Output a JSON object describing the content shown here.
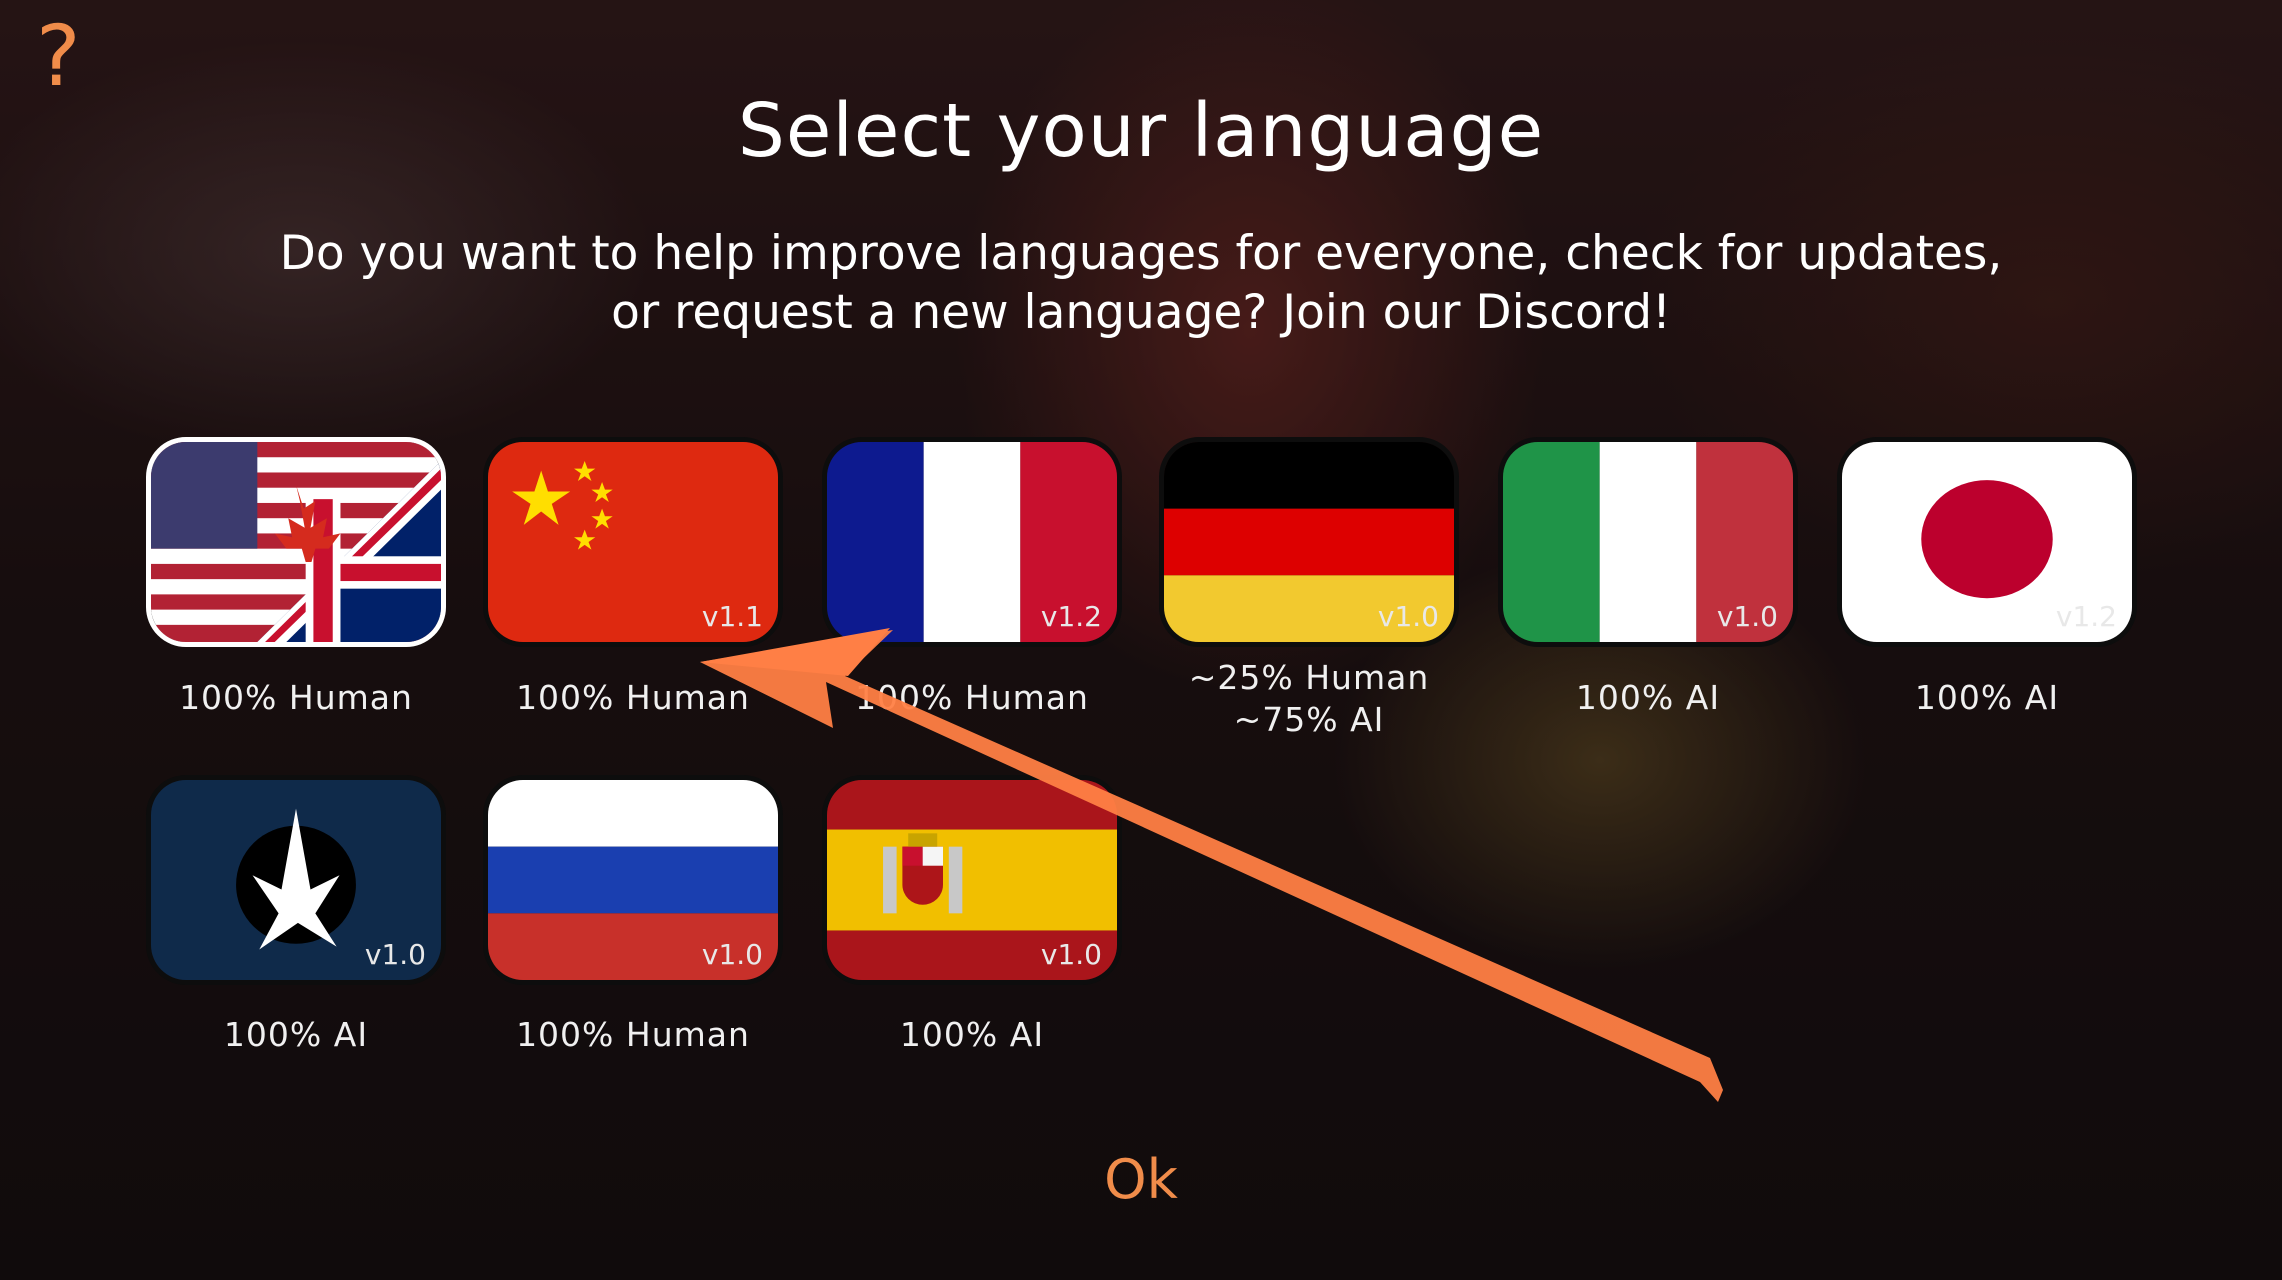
{
  "help": {
    "icon": "question-mark-icon",
    "glyph": "?"
  },
  "title": "Select your language",
  "subtitle": {
    "line1": "Do you want to help improve languages for everyone, check for updates,",
    "line2": "or request a new language? Join our Discord!"
  },
  "languages": [
    {
      "flag": "us-canada-uk-flag-icon",
      "version": "",
      "label": "100% Human",
      "label2": ""
    },
    {
      "flag": "china-flag-icon",
      "version": "v1.1",
      "label": "100% Human",
      "label2": ""
    },
    {
      "flag": "france-flag-icon",
      "version": "v1.2",
      "label": "100% Human",
      "label2": ""
    },
    {
      "flag": "germany-flag-icon",
      "version": "v1.0",
      "label": "~25% Human",
      "label2": "~75% AI"
    },
    {
      "flag": "italy-flag-icon",
      "version": "v1.0",
      "label": "100% AI",
      "label2": ""
    },
    {
      "flag": "japan-flag-icon",
      "version": "v1.2",
      "label": "100% AI",
      "label2": ""
    },
    {
      "flag": "klingon-emblem-icon",
      "version": "v1.0",
      "label": "100% AI",
      "label2": ""
    },
    {
      "flag": "russia-flag-icon",
      "version": "v1.0",
      "label": "100% Human",
      "label2": ""
    },
    {
      "flag": "spain-flag-icon",
      "version": "v1.0",
      "label": "100% AI",
      "label2": ""
    }
  ],
  "ok_label": "Ok",
  "colors": {
    "accent": "#f08c4a",
    "arrow": "#ff7f45"
  }
}
